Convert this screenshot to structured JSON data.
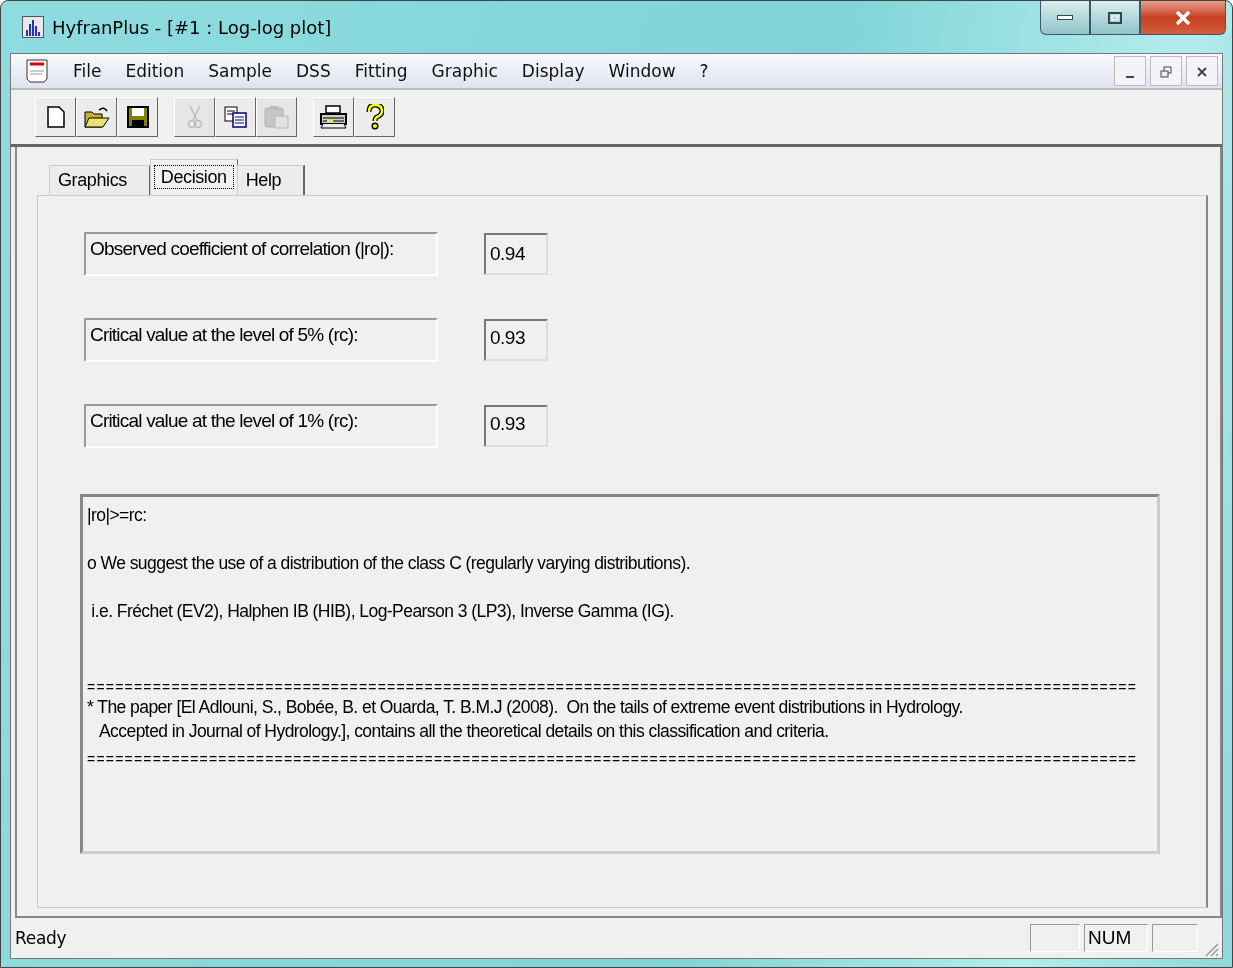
{
  "window": {
    "title": "HyfranPlus - [#1 :  Log-log plot]"
  },
  "menu": [
    "File",
    "Edition",
    "Sample",
    "DSS",
    "Fitting",
    "Graphic",
    "Display",
    "Window",
    "?"
  ],
  "toolbar": [
    {
      "kind": "new",
      "disabled": false
    },
    {
      "kind": "open",
      "disabled": false
    },
    {
      "kind": "save",
      "disabled": false
    },
    {
      "kind": "cut",
      "disabled": true
    },
    {
      "kind": "copy",
      "disabled": false
    },
    {
      "kind": "paste",
      "disabled": true
    },
    {
      "kind": "print",
      "disabled": false
    },
    {
      "kind": "help",
      "disabled": false
    }
  ],
  "tabs": [
    {
      "label": "Graphics",
      "selected": false
    },
    {
      "label": "Decision",
      "selected": true
    },
    {
      "label": "Help",
      "selected": false
    }
  ],
  "fields": [
    {
      "label": "Observed coefficient of correlation (|ro|):",
      "value": "0.94"
    },
    {
      "label": "Critical value at the level of 5% (rc):",
      "value": "0.93"
    },
    {
      "label": "Critical value at the level of 1% (rc):",
      "value": "0.93"
    }
  ],
  "report": [
    {
      "kind": "text",
      "text": "|ro|>=rc:"
    },
    {
      "kind": "blank"
    },
    {
      "kind": "text",
      "text": "o We suggest the use of a distribution of the class C (regularly varying distributions)."
    },
    {
      "kind": "blank"
    },
    {
      "kind": "text",
      "text": " i.e. Fréchet (EV2), Halphen IB (HIB), Log-Pearson 3 (LP3), Inverse Gamma (IG)."
    },
    {
      "kind": "blank"
    },
    {
      "kind": "blank"
    },
    {
      "kind": "rule",
      "text": "================================================================================================================"
    },
    {
      "kind": "text",
      "text": "* The paper [El Adlouni, S., Bobée, B. et Ouarda, T. B.M.J (2008).  On the tails of extreme event distributions in Hydrology."
    },
    {
      "kind": "text",
      "text": "   Accepted in Journal of Hydrology.], contains all the theoretical details on this classification and criteria."
    },
    {
      "kind": "rule",
      "text": "================================================================================================================"
    }
  ],
  "status_bar": {
    "text": "Ready",
    "num": "NUM"
  }
}
